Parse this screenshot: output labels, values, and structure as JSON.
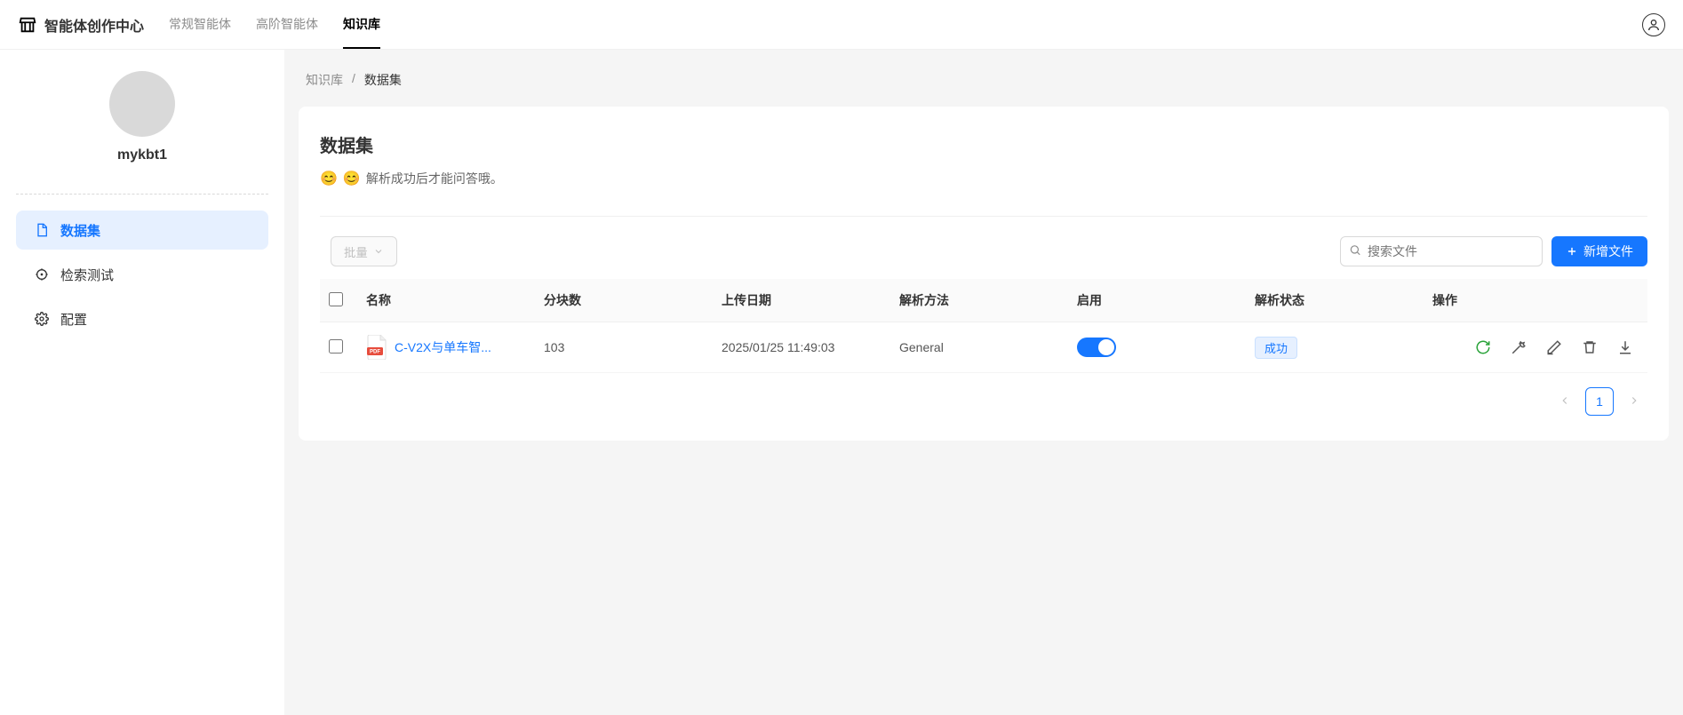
{
  "header": {
    "brand": "智能体创作中心",
    "tabs": [
      "常规智能体",
      "高阶智能体",
      "知识库"
    ]
  },
  "sidebar": {
    "username": "mykbt1",
    "items": [
      {
        "label": "数据集"
      },
      {
        "label": "检索测试"
      },
      {
        "label": "配置"
      }
    ]
  },
  "breadcrumb": {
    "root": "知识库",
    "sep": "/",
    "current": "数据集"
  },
  "panel": {
    "title": "数据集",
    "subtitle": "解析成功后才能问答哦。"
  },
  "toolbar": {
    "bulk_label": "批量",
    "search_placeholder": "搜索文件",
    "add_label": "新增文件"
  },
  "table": {
    "headers": {
      "name": "名称",
      "chunks": "分块数",
      "upload_date": "上传日期",
      "method": "解析方法",
      "enable": "启用",
      "status": "解析状态",
      "ops": "操作"
    },
    "rows": [
      {
        "name": "C-V2X与单车智...",
        "chunks": "103",
        "upload_date": "2025/01/25 11:49:03",
        "method": "General",
        "enable": true,
        "status": "成功"
      }
    ]
  },
  "pagination": {
    "current": "1"
  }
}
